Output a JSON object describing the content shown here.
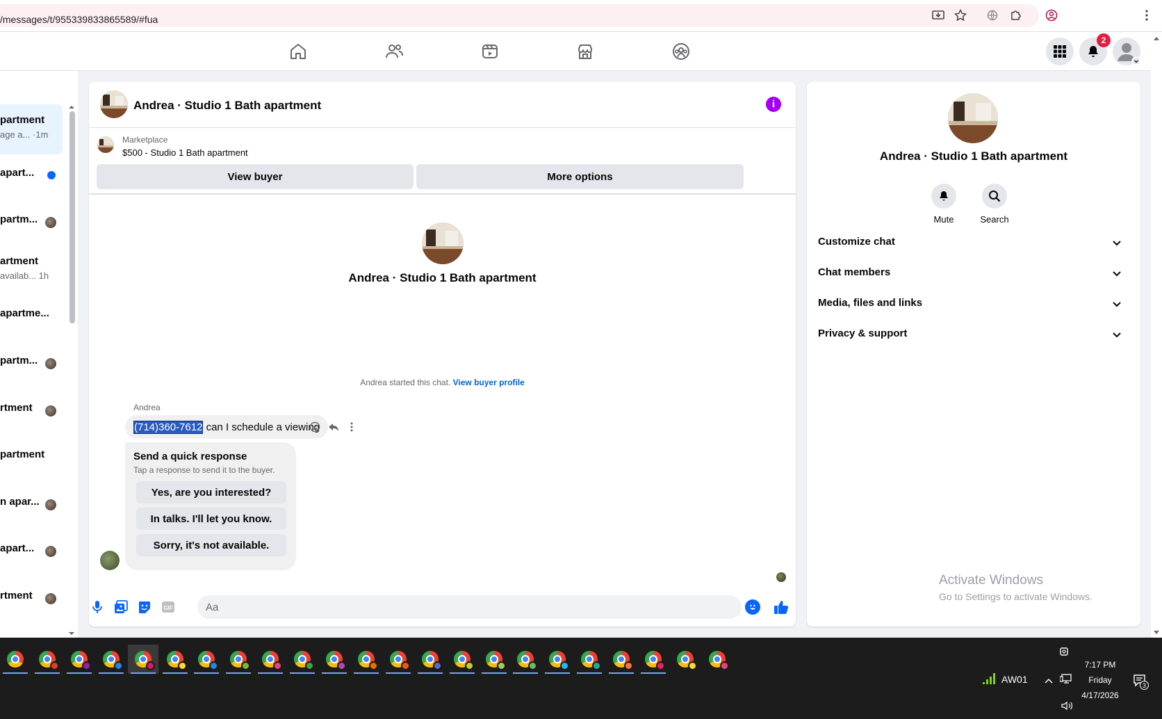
{
  "browser": {
    "url": "/messages/t/955339833865589/#fua"
  },
  "fb_nav": {
    "icons": [
      "home-icon",
      "friends-icon",
      "video-icon",
      "marketplace-icon",
      "groups-icon"
    ],
    "notification_count": "2"
  },
  "conversations": [
    {
      "title": "partment",
      "subtitle": "age a... ·1m",
      "active": true
    },
    {
      "title": "apart...",
      "marker": "unread-dot"
    },
    {
      "title": "partm...",
      "marker": "avatar"
    },
    {
      "title": "artment",
      "subtitle": "availab... 1h"
    },
    {
      "title": "apartme..."
    },
    {
      "title": "partm...",
      "marker": "avatar"
    },
    {
      "title": "rtment",
      "marker": "avatar"
    },
    {
      "title": "partment"
    },
    {
      "title": "n apar...",
      "marker": "avatar"
    },
    {
      "title": "apart...",
      "marker": "avatar"
    },
    {
      "title": "rtment",
      "marker": "avatar"
    }
  ],
  "chat": {
    "header_title": "Andrea · Studio 1 Bath apartment",
    "marketplace_label": "Marketplace",
    "listing": "$500 - Studio 1 Bath apartment",
    "view_buyer": "View buyer",
    "more_options": "More options",
    "intro_title": "Andrea · Studio 1 Bath apartment",
    "started_note": "Andrea started this chat.",
    "view_buyer_profile": "View buyer profile",
    "sender": "Andrea",
    "message_phone": "(714)360-7612",
    "message_rest": " can I schedule a viewing",
    "quick_title": "Send a quick response",
    "quick_subtitle": "Tap a response to send it to the buyer.",
    "quick_replies": [
      "Yes, are you interested?",
      "In talks. I'll let you know.",
      "Sorry, it's not available."
    ],
    "input_placeholder": "Aa"
  },
  "info_panel": {
    "title": "Andrea · Studio 1 Bath apartment",
    "mute": "Mute",
    "search": "Search",
    "sections": [
      "Customize chat",
      "Chat members",
      "Media, files and links",
      "Privacy & support"
    ],
    "watermark_title": "Activate Windows",
    "watermark_sub": "Go to Settings to activate Windows."
  },
  "taskbar": {
    "app_count": 23,
    "network": "AW01",
    "time": "7:17 PM",
    "day": "Friday",
    "date": "4/17/2026",
    "notifications": "3",
    "profile_colors": [
      "#e53935",
      "#8e24aa",
      "#1e88e5",
      "#d81b60",
      "#fdd835",
      "#1e88e5",
      "#7cb342",
      "#ec407a",
      "#43a047",
      "#ab47bc",
      "#ef6c00",
      "#f4511e",
      "#5c6bc0",
      "#c0ca33",
      "#9ccc65",
      "#66bb6a",
      "#29b6f6",
      "#26a69a",
      "#ff7043",
      "#e91e63",
      "#fdd835",
      "#ec407a"
    ]
  }
}
